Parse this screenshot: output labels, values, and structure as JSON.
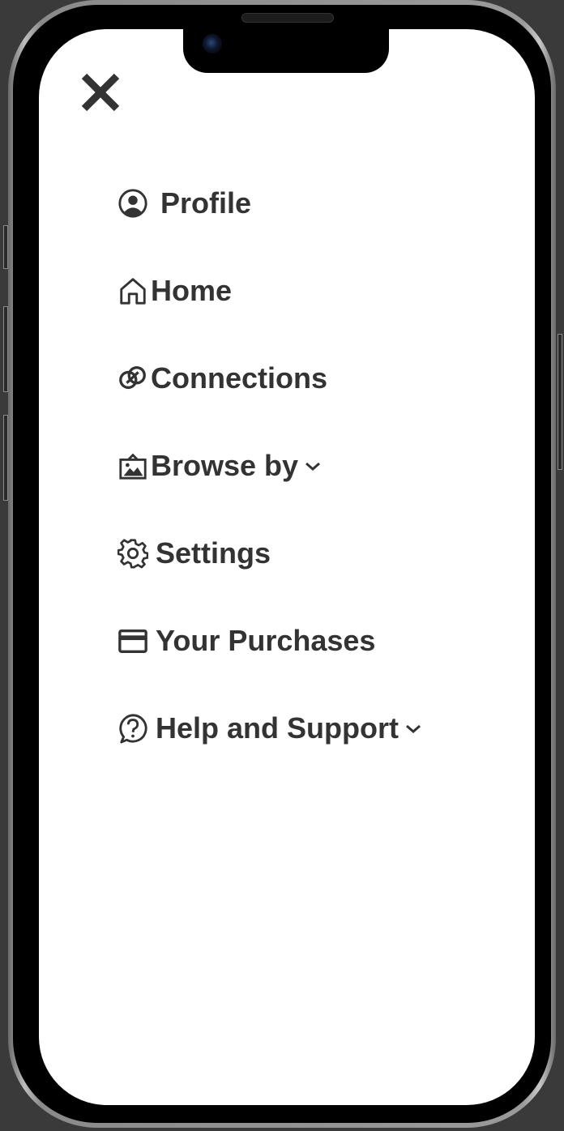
{
  "close_icon": "close-icon",
  "menu": {
    "items": [
      {
        "label": "Profile",
        "icon": "user-circle-icon"
      },
      {
        "label": "Home",
        "icon": "home-icon"
      },
      {
        "label": "Connections",
        "icon": "connections-icon"
      },
      {
        "label": "Browse by",
        "icon": "image-icon",
        "has_dropdown": true
      },
      {
        "label": "Settings",
        "icon": "gear-icon"
      },
      {
        "label": "Your Purchases",
        "icon": "credit-card-icon"
      },
      {
        "label": "Help and Support",
        "icon": "help-bubble-icon",
        "has_dropdown": true
      }
    ]
  },
  "colors": {
    "text": "#333333",
    "background": "#ffffff",
    "frame": "#000000"
  }
}
